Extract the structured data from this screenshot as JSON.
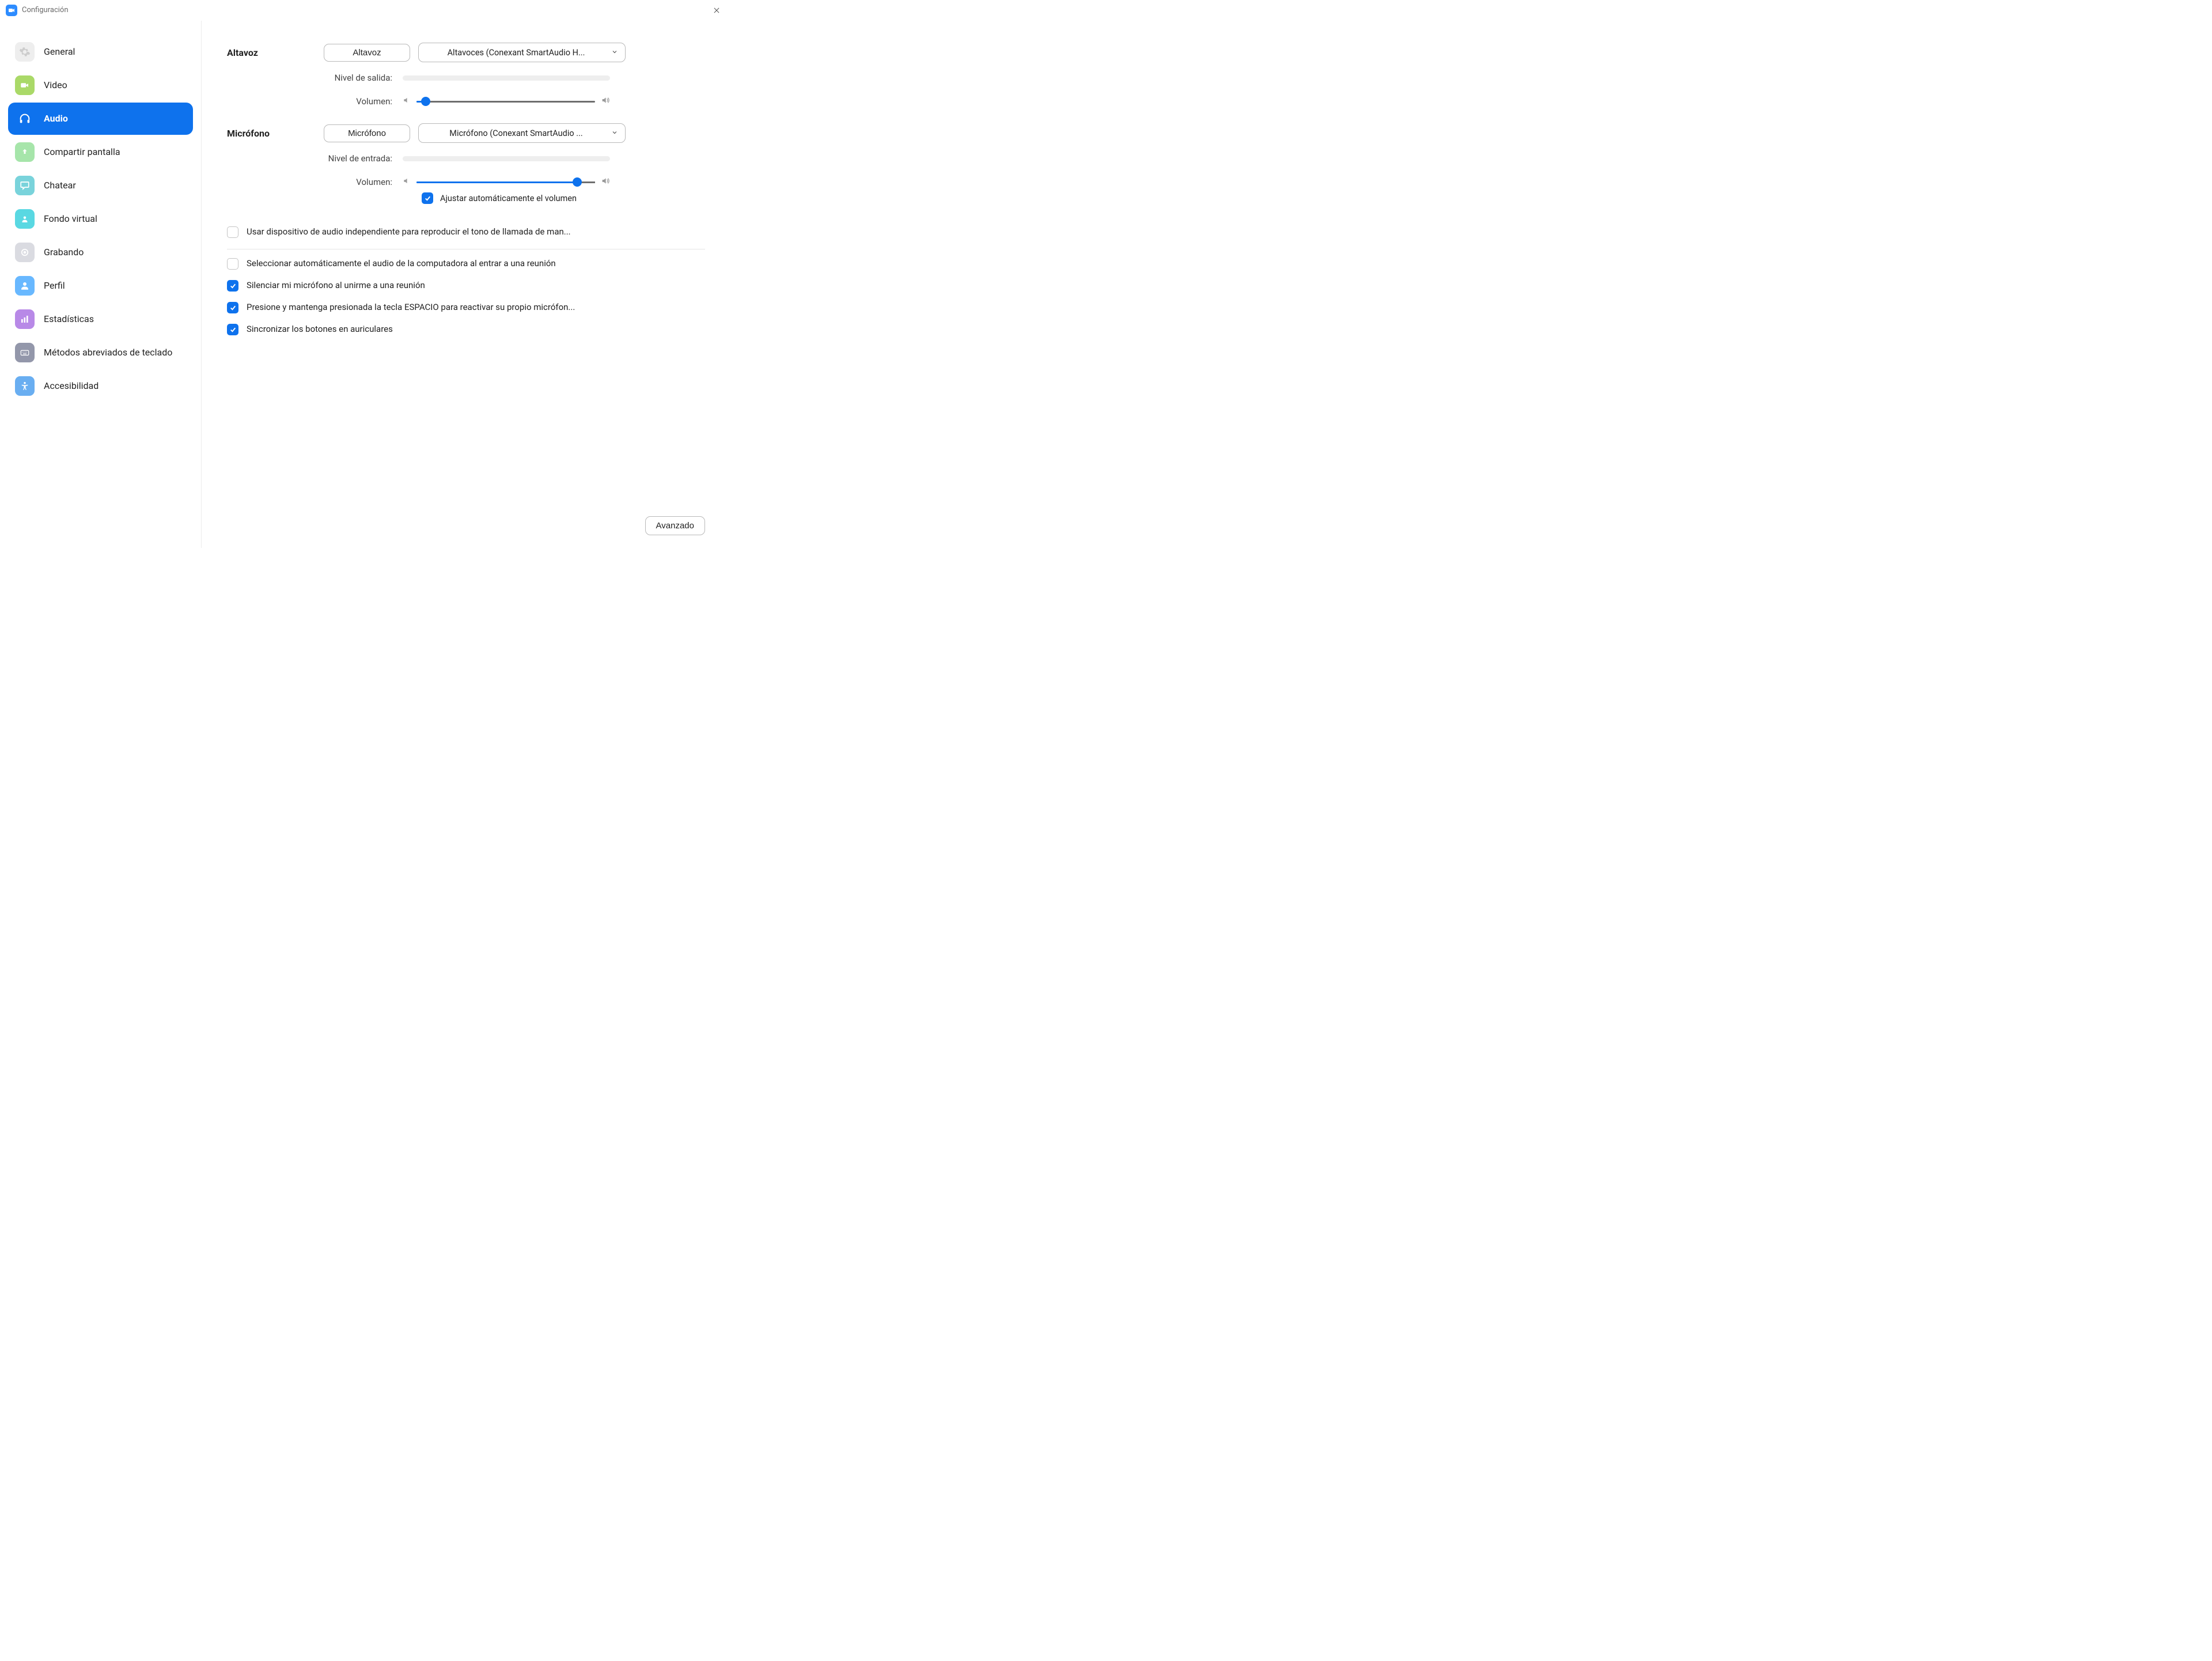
{
  "window": {
    "title": "Configuración"
  },
  "sidebar": {
    "items": [
      {
        "id": "general",
        "label": "General"
      },
      {
        "id": "video",
        "label": "Video"
      },
      {
        "id": "audio",
        "label": "Audio"
      },
      {
        "id": "share",
        "label": "Compartir pantalla"
      },
      {
        "id": "chat",
        "label": "Chatear"
      },
      {
        "id": "vbg",
        "label": "Fondo virtual"
      },
      {
        "id": "recording",
        "label": "Grabando"
      },
      {
        "id": "profile",
        "label": "Perfil"
      },
      {
        "id": "stats",
        "label": "Estadísticas"
      },
      {
        "id": "shortcuts",
        "label": "Métodos abreviados de teclado"
      },
      {
        "id": "accessibility",
        "label": "Accesibilidad"
      }
    ],
    "active": "audio"
  },
  "audio": {
    "speaker": {
      "section": "Altavoz",
      "test_button": "Altavoz",
      "device": "Altavoces (Conexant SmartAudio H...",
      "output_level_label": "Nivel de salida:",
      "volume_label": "Volumen:",
      "volume_percent": 5
    },
    "mic": {
      "section": "Micrófono",
      "test_button": "Micrófono",
      "device": "Micrófono (Conexant SmartAudio ...",
      "input_level_label": "Nivel de entrada:",
      "volume_label": "Volumen:",
      "volume_percent": 90,
      "auto_adjust": "Ajustar automáticamente el volumen"
    },
    "options": {
      "use_separate_ringtone": "Usar dispositivo de audio independiente para reproducir el tono de llamada de man...",
      "auto_join_audio": "Seleccionar automáticamente el audio de la computadora al entrar a una reunión",
      "mute_on_join": "Silenciar mi micrófono al unirme a una reunión",
      "space_to_unmute": "Presione y mantenga presionada la tecla ESPACIO para reactivar su propio micrófon...",
      "sync_headset": "Sincronizar los botones en auriculares"
    },
    "advanced": "Avanzado"
  },
  "icons": {
    "general_bg": "#EDEDED",
    "video_bg": "#A3D65C",
    "share_bg": "#9FE3A3",
    "chat_bg": "#6ED0D8",
    "vbg_bg": "#4CD5E0",
    "recording_bg": "#D7D9DF",
    "profile_bg": "#5CB3FF",
    "stats_bg": "#B380E6",
    "shortcuts_bg": "#8A8FA3",
    "accessibility_bg": "#5DA8F0"
  }
}
